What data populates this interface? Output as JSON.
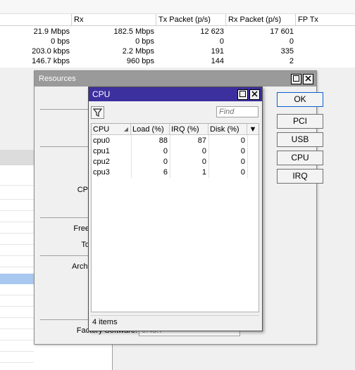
{
  "background_table": {
    "columns": [
      "",
      "Rx",
      "Tx Packet (p/s)",
      "Rx Packet (p/s)",
      "FP Tx"
    ],
    "rows": [
      [
        "21.9 Mbps",
        "182.5 Mbps",
        "12 623",
        "17 601"
      ],
      [
        "0 bps",
        "0 bps",
        "0",
        "0"
      ],
      [
        "203.0 kbps",
        "2.2 Mbps",
        "191",
        "335"
      ],
      [
        "146.7 kbps",
        "960 bps",
        "144",
        "2"
      ]
    ]
  },
  "resources_dialog": {
    "title": "Resources",
    "labels": {
      "cpu_partial": "CP",
      "free_partial": "Free",
      "total_partial": "To",
      "arch_partial": "Archi",
      "factory_software": "Factory Software:",
      "factory_software_value": "6.43.7"
    },
    "buttons": {
      "ok": "OK",
      "pci": "PCI",
      "usb": "USB",
      "cpu": "CPU",
      "irq": "IRQ"
    }
  },
  "cpu_dialog": {
    "title": "CPU",
    "find_placeholder": "Find",
    "columns": [
      "CPU",
      "Load (%)",
      "IRQ (%)",
      "Disk (%)"
    ],
    "rows": [
      {
        "cpu": "cpu0",
        "load": "88",
        "irq": "87",
        "disk": "0"
      },
      {
        "cpu": "cpu1",
        "load": "0",
        "irq": "0",
        "disk": "0"
      },
      {
        "cpu": "cpu2",
        "load": "0",
        "irq": "0",
        "disk": "0"
      },
      {
        "cpu": "cpu3",
        "load": "6",
        "irq": "1",
        "disk": "0"
      }
    ],
    "status": "4 items"
  },
  "colors": {
    "cpu_titlebar": "#3c2f9e",
    "resources_titlebar": "#9a9a9a",
    "selection": "#a8c8ef"
  },
  "icons": {
    "filter": "filter-icon",
    "restore": "restore-icon",
    "close": "close-icon",
    "sort": "sort-arrow-icon",
    "column_menu": "dropdown-arrow-icon"
  }
}
